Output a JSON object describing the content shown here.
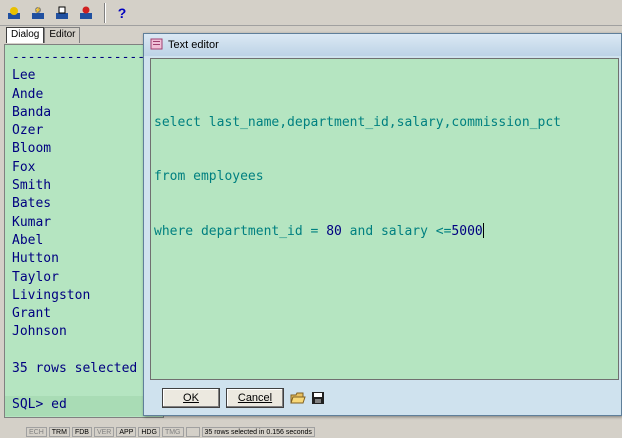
{
  "toolbar": {
    "icons": [
      "connect-icon",
      "disconnect-icon",
      "run-script-icon",
      "stop-icon"
    ],
    "help_label": "?"
  },
  "tabs": [
    {
      "label": "Dialog",
      "active": true
    },
    {
      "label": "Editor",
      "active": false
    }
  ],
  "sql_output": {
    "separator": "-----------------",
    "names": [
      "Lee",
      "Ande",
      "Banda",
      "Ozer",
      "Bloom",
      "Fox",
      "Smith",
      "Bates",
      "Kumar",
      "Abel",
      "Hutton",
      "Taylor",
      "Livingston",
      "Grant",
      "Johnson"
    ],
    "rows_selected": "35 rows selected",
    "prompt": "SQL> ed"
  },
  "editor_dialog": {
    "title": "Text editor",
    "lines": {
      "line1": "select last_name,department_id,salary,commission_pct",
      "line2": "from employees",
      "line3_pre": "where department_id = ",
      "line3_num1": "80",
      "line3_mid": " and salary <=",
      "line3_num2": "5000"
    },
    "ok_label": "OK",
    "cancel_label": "Cancel"
  },
  "statusbar": {
    "items": [
      "ECH",
      "TRM",
      "FDB",
      "VER",
      "APP",
      "HDG",
      "TMG",
      "",
      "35 rows selected in 0.156 seconds"
    ],
    "on": [
      false,
      true,
      true,
      false,
      true,
      true,
      false,
      true,
      true
    ]
  },
  "colors": {
    "editor_bg": "#b5e5c1",
    "keyword": "#008080",
    "number": "#000080"
  }
}
